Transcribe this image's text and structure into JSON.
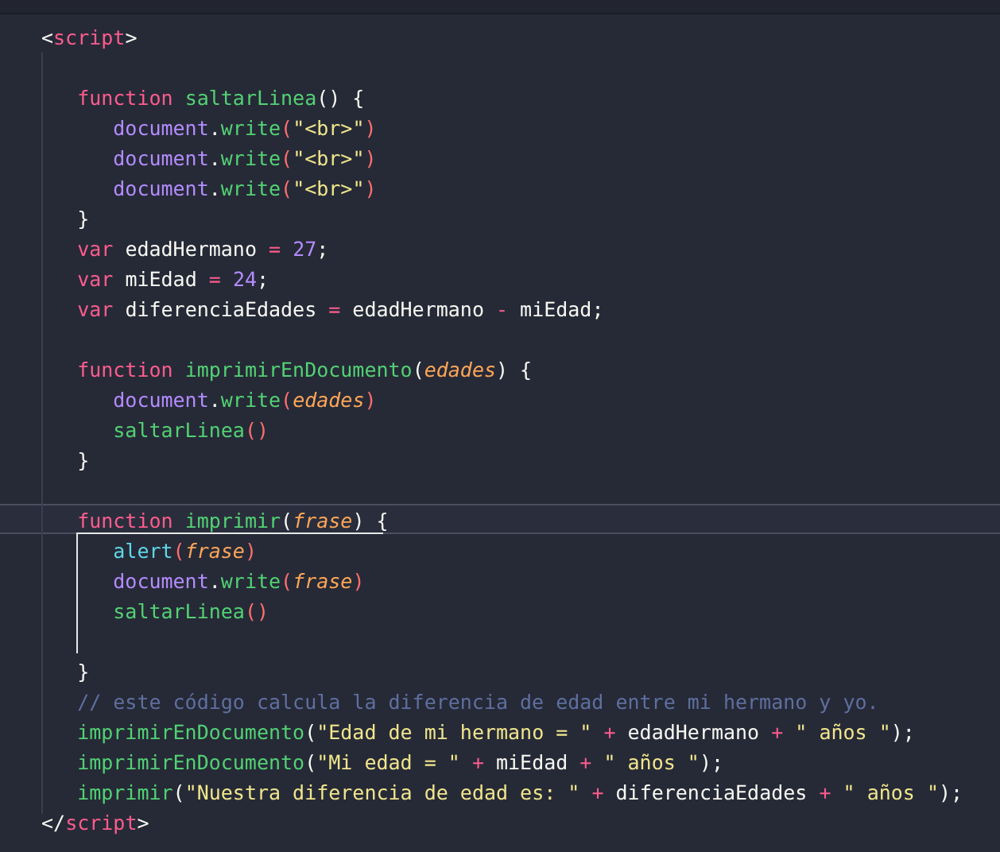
{
  "editor": {
    "lines": [
      {
        "selected": false,
        "tokens": [
          {
            "kind": "punct",
            "text": "<"
          },
          {
            "kind": "tag",
            "text": "script"
          },
          {
            "kind": "punct",
            "text": ">"
          }
        ]
      },
      {
        "selected": false
      },
      {
        "selected": false,
        "tokens": [
          {
            "kind": "kw",
            "text": "   function "
          },
          {
            "kind": "fn",
            "text": "saltarLinea"
          },
          {
            "kind": "punct",
            "text": "() {"
          }
        ]
      },
      {
        "selected": false,
        "tokens": [
          {
            "kind": "obj",
            "text": "      document"
          },
          {
            "kind": "punct",
            "text": "."
          },
          {
            "kind": "fn",
            "text": "write"
          },
          {
            "kind": "paren",
            "text": "("
          },
          {
            "kind": "str",
            "text": "\"<br>\""
          },
          {
            "kind": "paren",
            "text": ")"
          }
        ]
      },
      {
        "selected": false,
        "tokens": [
          {
            "kind": "obj",
            "text": "      document"
          },
          {
            "kind": "punct",
            "text": "."
          },
          {
            "kind": "fn",
            "text": "write"
          },
          {
            "kind": "paren",
            "text": "("
          },
          {
            "kind": "str",
            "text": "\"<br>\""
          },
          {
            "kind": "paren",
            "text": ")"
          }
        ]
      },
      {
        "selected": false,
        "tokens": [
          {
            "kind": "obj",
            "text": "      document"
          },
          {
            "kind": "punct",
            "text": "."
          },
          {
            "kind": "fn",
            "text": "write"
          },
          {
            "kind": "paren",
            "text": "("
          },
          {
            "kind": "str",
            "text": "\"<br>\""
          },
          {
            "kind": "paren",
            "text": ")"
          }
        ]
      },
      {
        "selected": false,
        "tokens": [
          {
            "kind": "punct",
            "text": "   }"
          }
        ]
      },
      {
        "selected": false,
        "tokens": [
          {
            "kind": "kw",
            "text": "   var "
          },
          {
            "kind": "plain",
            "text": "edadHermano "
          },
          {
            "kind": "op",
            "text": "= "
          },
          {
            "kind": "num",
            "text": "27"
          },
          {
            "kind": "punct",
            "text": ";"
          }
        ]
      },
      {
        "selected": false,
        "tokens": [
          {
            "kind": "kw",
            "text": "   var "
          },
          {
            "kind": "plain",
            "text": "miEdad "
          },
          {
            "kind": "op",
            "text": "= "
          },
          {
            "kind": "num",
            "text": "24"
          },
          {
            "kind": "punct",
            "text": ";"
          }
        ]
      },
      {
        "selected": false,
        "tokens": [
          {
            "kind": "kw",
            "text": "   var "
          },
          {
            "kind": "plain",
            "text": "diferenciaEdades "
          },
          {
            "kind": "op",
            "text": "="
          },
          {
            "kind": "plain",
            "text": " edadHermano "
          },
          {
            "kind": "op",
            "text": "-"
          },
          {
            "kind": "plain",
            "text": " miEdad;"
          }
        ]
      },
      {
        "selected": false
      },
      {
        "selected": false,
        "tokens": [
          {
            "kind": "kw",
            "text": "   function "
          },
          {
            "kind": "fn",
            "text": "imprimirEnDocumento"
          },
          {
            "kind": "punct",
            "text": "("
          },
          {
            "kind": "param",
            "text": "edades"
          },
          {
            "kind": "punct",
            "text": ") {"
          }
        ]
      },
      {
        "selected": false,
        "tokens": [
          {
            "kind": "obj",
            "text": "      document"
          },
          {
            "kind": "punct",
            "text": "."
          },
          {
            "kind": "fn",
            "text": "write"
          },
          {
            "kind": "paren",
            "text": "("
          },
          {
            "kind": "param",
            "text": "edades"
          },
          {
            "kind": "paren",
            "text": ")"
          }
        ]
      },
      {
        "selected": false,
        "tokens": [
          {
            "kind": "fn",
            "text": "      saltarLinea"
          },
          {
            "kind": "paren",
            "text": "()"
          }
        ]
      },
      {
        "selected": false,
        "tokens": [
          {
            "kind": "punct",
            "text": "   }"
          }
        ]
      },
      {
        "selected": false
      },
      {
        "selected": true,
        "tokens": [
          {
            "kind": "kw",
            "text": "   function "
          },
          {
            "kind": "fn",
            "text": "imprimir"
          },
          {
            "kind": "punct",
            "text": "("
          },
          {
            "kind": "param",
            "text": "frase"
          },
          {
            "kind": "punct",
            "text": ") {"
          }
        ]
      },
      {
        "selected": false,
        "tokens": [
          {
            "kind": "call",
            "text": "      alert"
          },
          {
            "kind": "paren",
            "text": "("
          },
          {
            "kind": "param",
            "text": "frase"
          },
          {
            "kind": "paren",
            "text": ")"
          }
        ]
      },
      {
        "selected": false,
        "tokens": [
          {
            "kind": "obj",
            "text": "      document"
          },
          {
            "kind": "punct",
            "text": "."
          },
          {
            "kind": "fn",
            "text": "write"
          },
          {
            "kind": "paren",
            "text": "("
          },
          {
            "kind": "param",
            "text": "frase"
          },
          {
            "kind": "paren",
            "text": ")"
          }
        ]
      },
      {
        "selected": false,
        "tokens": [
          {
            "kind": "fn",
            "text": "      saltarLinea"
          },
          {
            "kind": "paren",
            "text": "()"
          }
        ]
      },
      {
        "selected": false
      },
      {
        "selected": false,
        "tokens": [
          {
            "kind": "punct",
            "text": "   }"
          }
        ]
      },
      {
        "selected": false,
        "tokens": [
          {
            "kind": "comment",
            "text": "   // este código calcula la diferencia de edad entre mi hermano y yo."
          }
        ]
      },
      {
        "selected": false,
        "tokens": [
          {
            "kind": "fn",
            "text": "   imprimirEnDocumento"
          },
          {
            "kind": "punct",
            "text": "("
          },
          {
            "kind": "str",
            "text": "\"Edad de mi hermano = \""
          },
          {
            "kind": "op",
            "text": " + "
          },
          {
            "kind": "plain",
            "text": "edadHermano"
          },
          {
            "kind": "op",
            "text": " + "
          },
          {
            "kind": "str",
            "text": "\" años \""
          },
          {
            "kind": "punct",
            "text": ");"
          }
        ]
      },
      {
        "selected": false,
        "tokens": [
          {
            "kind": "fn",
            "text": "   imprimirEnDocumento"
          },
          {
            "kind": "punct",
            "text": "("
          },
          {
            "kind": "str",
            "text": "\"Mi edad = \""
          },
          {
            "kind": "op",
            "text": " + "
          },
          {
            "kind": "plain",
            "text": "miEdad"
          },
          {
            "kind": "op",
            "text": " + "
          },
          {
            "kind": "str",
            "text": "\" años \""
          },
          {
            "kind": "punct",
            "text": ");"
          }
        ]
      },
      {
        "selected": false,
        "tokens": [
          {
            "kind": "fn",
            "text": "   imprimir"
          },
          {
            "kind": "punct",
            "text": "("
          },
          {
            "kind": "str",
            "text": "\"Nuestra diferencia de edad es: \""
          },
          {
            "kind": "op",
            "text": " + "
          },
          {
            "kind": "plain",
            "text": "diferenciaEdades"
          },
          {
            "kind": "op",
            "text": " + "
          },
          {
            "kind": "str",
            "text": "\" años \""
          },
          {
            "kind": "punct",
            "text": ");"
          }
        ]
      },
      {
        "selected": false,
        "tokens": [
          {
            "kind": "punct",
            "text": "</"
          },
          {
            "kind": "tag",
            "text": "script"
          },
          {
            "kind": "punct",
            "text": ">"
          }
        ]
      }
    ]
  }
}
